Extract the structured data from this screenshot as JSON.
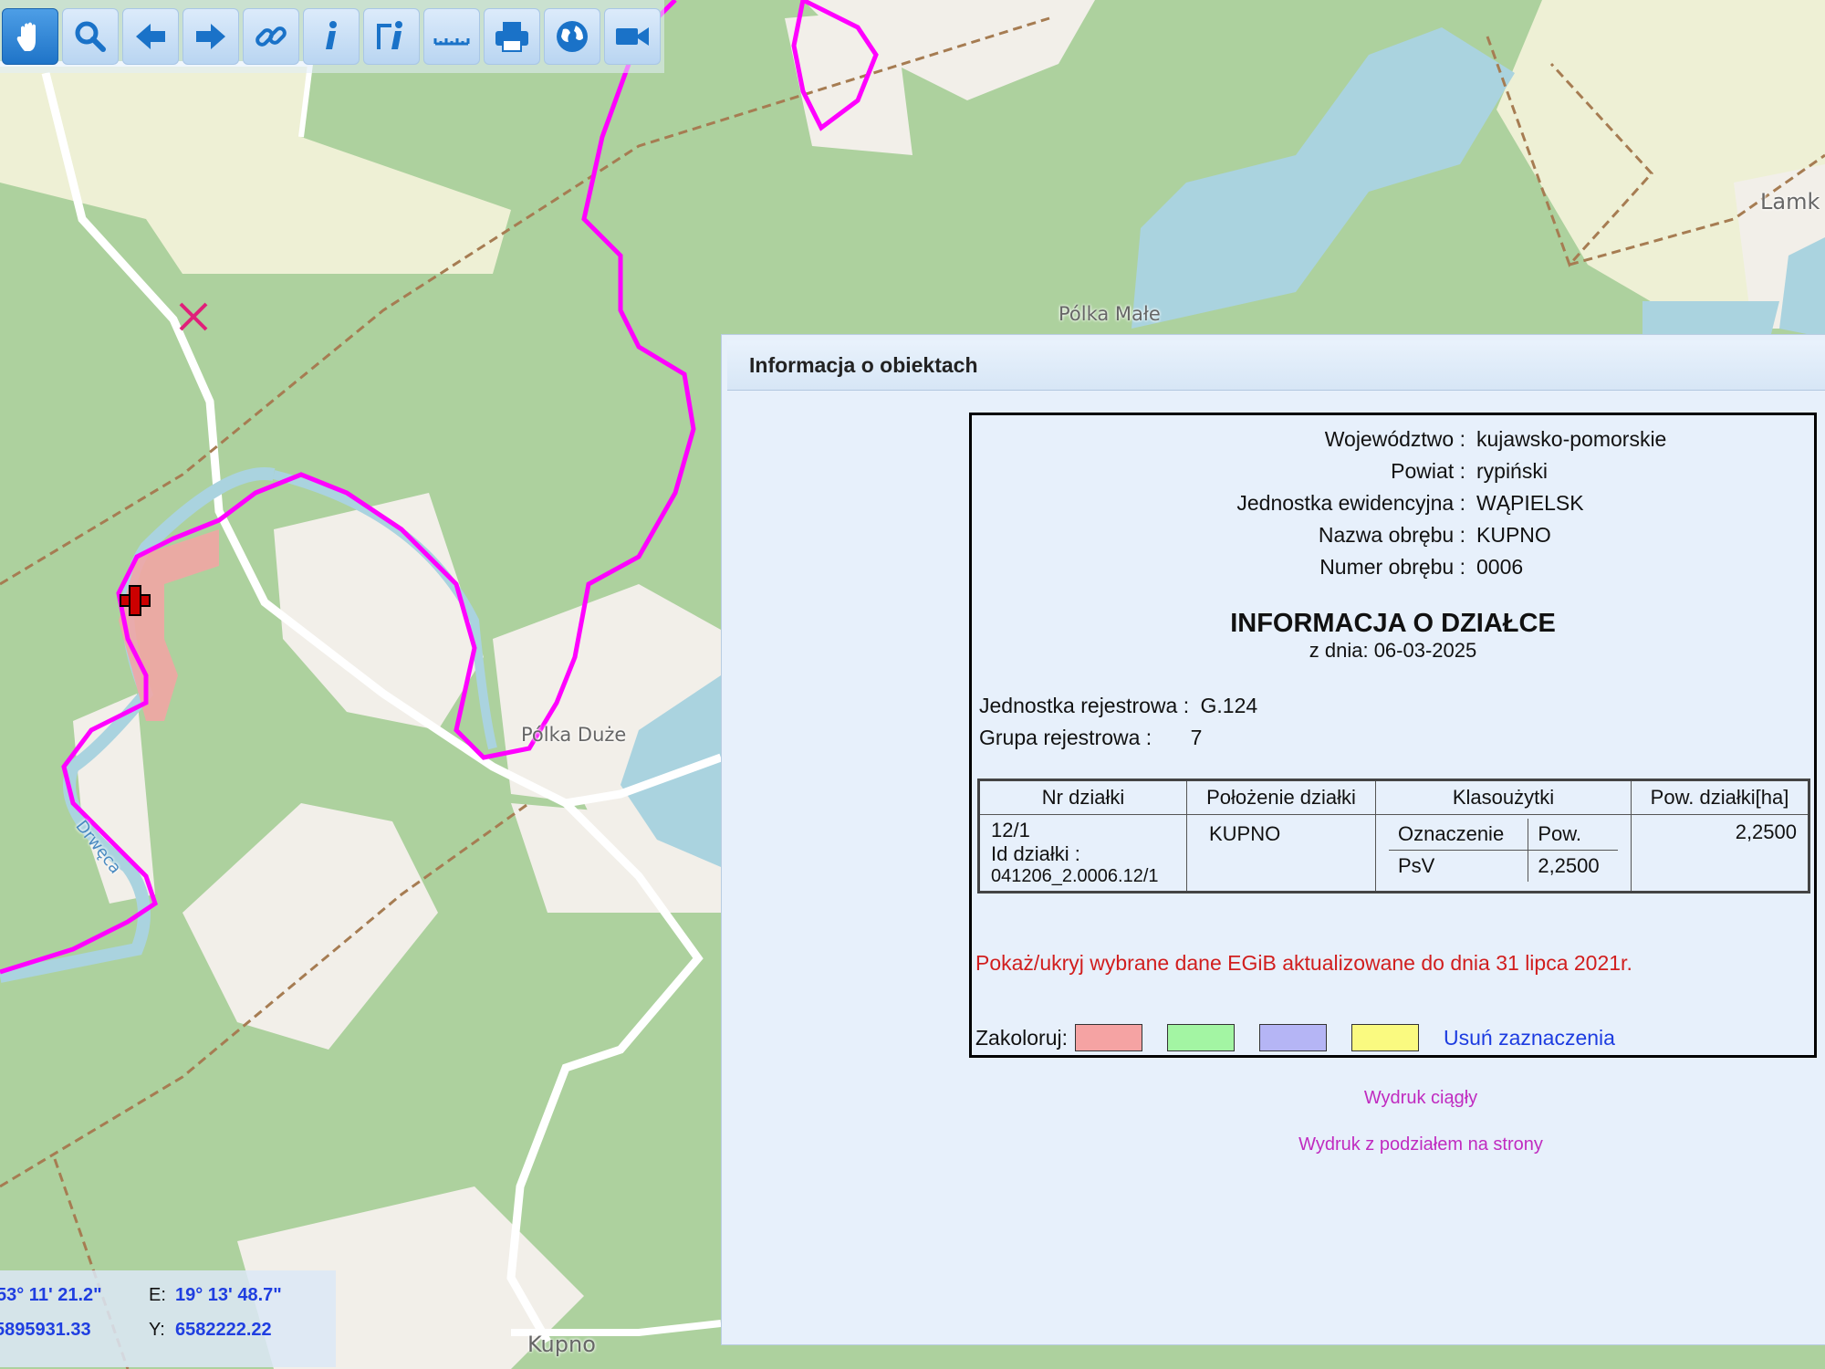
{
  "toolbar": {
    "buttons": [
      {
        "icon": "hand-pan-icon",
        "active": true
      },
      {
        "icon": "zoom-icon"
      },
      {
        "icon": "arrow-left-icon"
      },
      {
        "icon": "arrow-right-icon"
      },
      {
        "icon": "link-icon"
      },
      {
        "icon": "info-icon"
      },
      {
        "icon": "info-query-icon"
      },
      {
        "icon": "ruler-icon"
      },
      {
        "icon": "printer-icon"
      },
      {
        "icon": "globe-icon"
      },
      {
        "icon": "video-camera-icon"
      }
    ]
  },
  "map": {
    "labels": {
      "polka_male": "Pólka Małe",
      "polka_duze": "Pólka Duże",
      "kupno": "Kupno",
      "lamk": "Lamk",
      "drweca": "Drwęca"
    },
    "colors": {
      "forest": "#add19e",
      "field": "#f2efe9",
      "farmland": "#eef0d5",
      "water": "#aad3df",
      "boundary": "#ff00ff"
    }
  },
  "coords": {
    "lat_partial": "53° 11' 21.2\"",
    "e_label": "E:",
    "lon": "19° 13' 48.7\"",
    "x_partial": "5895931.33",
    "y_label": "Y:",
    "y": "6582222.22"
  },
  "dialog": {
    "title": "Informacja o obiektach",
    "admin": [
      {
        "label": "Województwo :",
        "value": "kujawsko-pomorskie"
      },
      {
        "label": "Powiat :",
        "value": "rypiński"
      },
      {
        "label": "Jednostka ewidencyjna :",
        "value": "WĄPIELSK"
      },
      {
        "label": "Nazwa obrębu :",
        "value": "KUPNO"
      },
      {
        "label": "Numer obrębu :",
        "value": "0006"
      }
    ],
    "info_title": "INFORMACJA O DZIAŁCE",
    "info_date": "z dnia: 06-03-2025",
    "jednostka_label": "Jednostka rejestrowa :",
    "jednostka_value": "G.124",
    "grupa_label": "Grupa rejestrowa :",
    "grupa_value": "7",
    "table": {
      "headers": [
        "Nr działki",
        "Położenie działki",
        "Klasoużytki",
        "Pow. działki[ha]"
      ],
      "nr": "12/1",
      "id_label": "Id działki :",
      "id_value": "041206_2.0006.12/1",
      "polozenie": "KUPNO",
      "klaso_headers": [
        "Oznaczenie",
        "Pow."
      ],
      "klaso_row": [
        "PsV",
        "2,2500"
      ],
      "pow": "2,2500"
    },
    "egib_link": "Pokaż/ukryj wybrane dane EGiB aktualizowane do dnia 31 lipca 2021r.",
    "colorize_label": "Zakoloruj:",
    "swatches": [
      "#f5a3a3",
      "#a3f5a3",
      "#b5b5f5",
      "#fafa80"
    ],
    "clear_label": "Usuń zaznaczenia",
    "print_continuous": "Wydruk ciągły",
    "print_pages": "Wydruk z podziałem na strony"
  }
}
